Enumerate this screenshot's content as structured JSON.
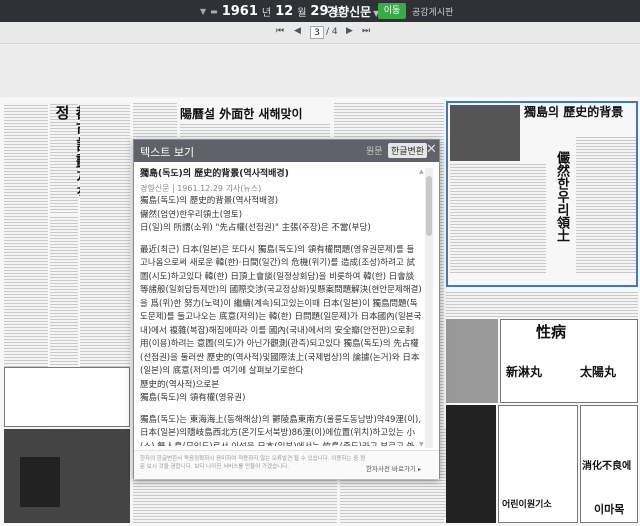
{
  "nav": {
    "year": "1961",
    "year_unit": "년",
    "month": "12",
    "month_unit": "월",
    "day": "29",
    "day_unit": "일",
    "newspaper": "경향신문",
    "go_label": "이동",
    "board_link": "공감게시판"
  },
  "pager": {
    "first": "⏮",
    "prev": "◀",
    "current": "3",
    "separator": "/",
    "total": "4",
    "next": "▶",
    "last": "⏭"
  },
  "page_headlines": {
    "left_vertical": "都市計劃재책정",
    "center_top": "陽曆설 外面한 새해맞이",
    "right_feature": "獨島의 歷史的背景",
    "right_vertical": "儼然한우리領土",
    "ad1": "性病",
    "ad2": "新淋丸",
    "ad3": "太陽丸",
    "ad4": "消化不良에",
    "ad5": "이마목",
    "ad6": "어린이원기소"
  },
  "modal": {
    "title": "텍스트 보기",
    "tab_original": "원문",
    "tab_converted": "한글변환",
    "close": "✕",
    "article_title": "獨島(독도)의 歷史的背景(역사적배경)",
    "meta": "경향신문 | 1961.12.29 기사(뉴스)",
    "para1": [
      "獨島(독도)의 歷史的背景(역사적배경)",
      "儼然(엄연)한우리領土(영토)",
      "日(일)의 所謂(소위) \"先占權(선점권)\" 主張(주장)은 不當(부당)"
    ],
    "para2": "最近(최근) 日本(일본)은 또다시 獨島(독도)의 領有權問題(영유권문제)를 들고나옴으로써 새로운 韓(한)·日間(일간)의 危機(위기)를 造成(조성)하려고 試圖(시도)하고있다 韓(한) 日頂上會談(일정상회담)을 비롯하여 韓(한) 日會談等諸般(일회담등제반)의 國際交涉(국교정상화)및懸案問題解決(현안문제해결)을 爲(위)한 努力(노력)이 繼續(계속)되고있는이때 日本(일본)이 獨島問題(독도문제)를 들고나오는 底意(저의)는 韓(한) 日問題(일문제)가 日本國內(일본국내)에서 複雜(복잡)해짐에따라 이를 國內(국내)에서의 安全瓣(안전판)으로利用(이용)하려는 意圖(의도)가 아닌가觀測(관측)되고있다 獨島(독도)의 先占權(선점권)을 둘러싼 歷史的(역사적)및國際法上(국제법상)의 論據(논거)와 日本(일본)의 底意(저의)를 여기에 살펴보기로한다",
    "para3": [
      "歷史的(역사적)으로본",
      "獨島(독도)의 領有權(영유권)"
    ],
    "para4": "獨島(독도)는 東海海上(동해해상)의 鬱陵島東南方(울릉도동남방)약49浬(이), 日本(일본)의隱岐島西北方(온기도서북방)86浬(이)에位置(위치)하고있는 小(소) 無人島(무인도)로서 이섬을 日本(일본)에서는 竹島(죽도)라고 부르고 外國人(외국인)들은 \"리앙쿠르\" 岩(암)이라고呼稱(호칭)하고있다",
    "footer_notice": "한자의 한글변환서 독음정확하시 음미하여 적용하지 않는 오류발견 될 수 있습니다. 이용하는 중 원문 보시 것을 권합니다. 보다 나아진 서비스를 만들어 가겠습니다.",
    "dict_label": "한자사전 바로가기"
  }
}
